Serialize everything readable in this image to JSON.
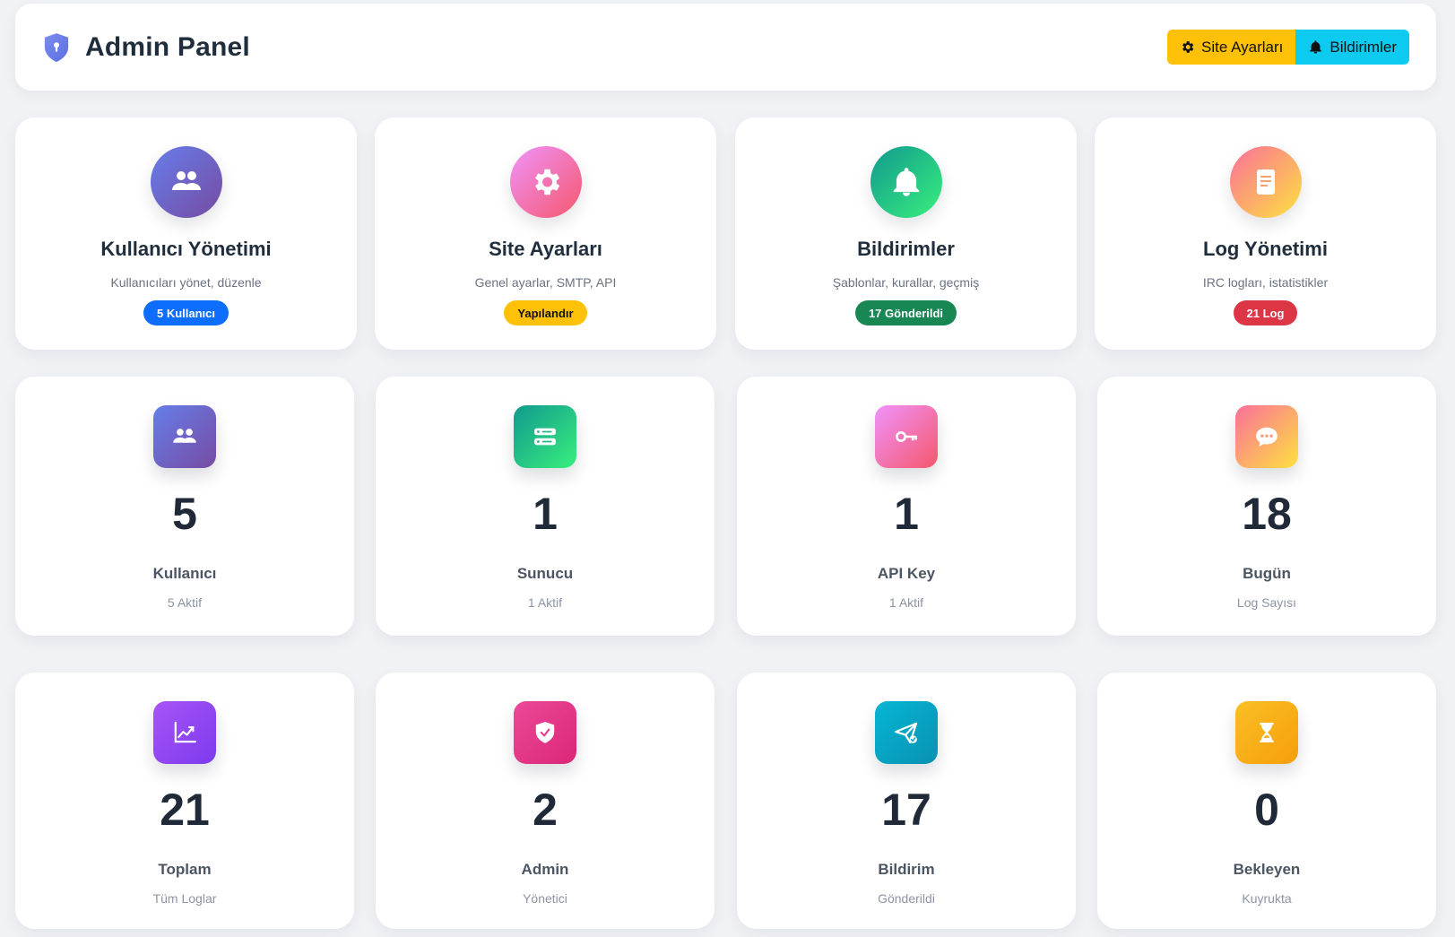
{
  "header": {
    "title": "Admin Panel",
    "brand_icon": "shield-lock-icon",
    "buttons": [
      {
        "label": "Site Ayarları",
        "icon": "gear-icon",
        "color": "#ffc107"
      },
      {
        "label": "Bildirimler",
        "icon": "bell-icon",
        "color": "#0dcaf0"
      }
    ]
  },
  "management": [
    {
      "title": "Kullanıcı Yönetimi",
      "desc": "Kullanıcıları yönet, düzenle",
      "badge": "5 Kullanıcı",
      "badge_color": "#0d6efd",
      "icon": "users-icon"
    },
    {
      "title": "Site Ayarları",
      "desc": "Genel ayarlar, SMTP, API",
      "badge": "Yapılandır",
      "badge_color": "#ffc107",
      "icon": "gear-icon"
    },
    {
      "title": "Bildirimler",
      "desc": "Şablonlar, kurallar, geçmiş",
      "badge": "17 Gönderildi",
      "badge_color": "#198754",
      "icon": "bell-icon"
    },
    {
      "title": "Log Yönetimi",
      "desc": "IRC logları, istatistikler",
      "badge": "21 Log",
      "badge_color": "#dc3545",
      "icon": "document-icon"
    }
  ],
  "stats": [
    {
      "value": "5",
      "label": "Kullanıcı",
      "sub": "5 Aktif",
      "icon": "users-icon"
    },
    {
      "value": "1",
      "label": "Sunucu",
      "sub": "1 Aktif",
      "icon": "server-icon"
    },
    {
      "value": "1",
      "label": "API Key",
      "sub": "1 Aktif",
      "icon": "key-icon"
    },
    {
      "value": "18",
      "label": "Bugün",
      "sub": "Log Sayısı",
      "icon": "chat-icon"
    },
    {
      "value": "21",
      "label": "Toplam",
      "sub": "Tüm Loglar",
      "icon": "chart-line-icon"
    },
    {
      "value": "2",
      "label": "Admin",
      "sub": "Yönetici",
      "icon": "shield-check-icon"
    },
    {
      "value": "17",
      "label": "Bildirim",
      "sub": "Gönderildi",
      "icon": "paper-plane-icon"
    },
    {
      "value": "0",
      "label": "Bekleyen",
      "sub": "Kuyrukta",
      "icon": "hourglass-icon"
    }
  ]
}
